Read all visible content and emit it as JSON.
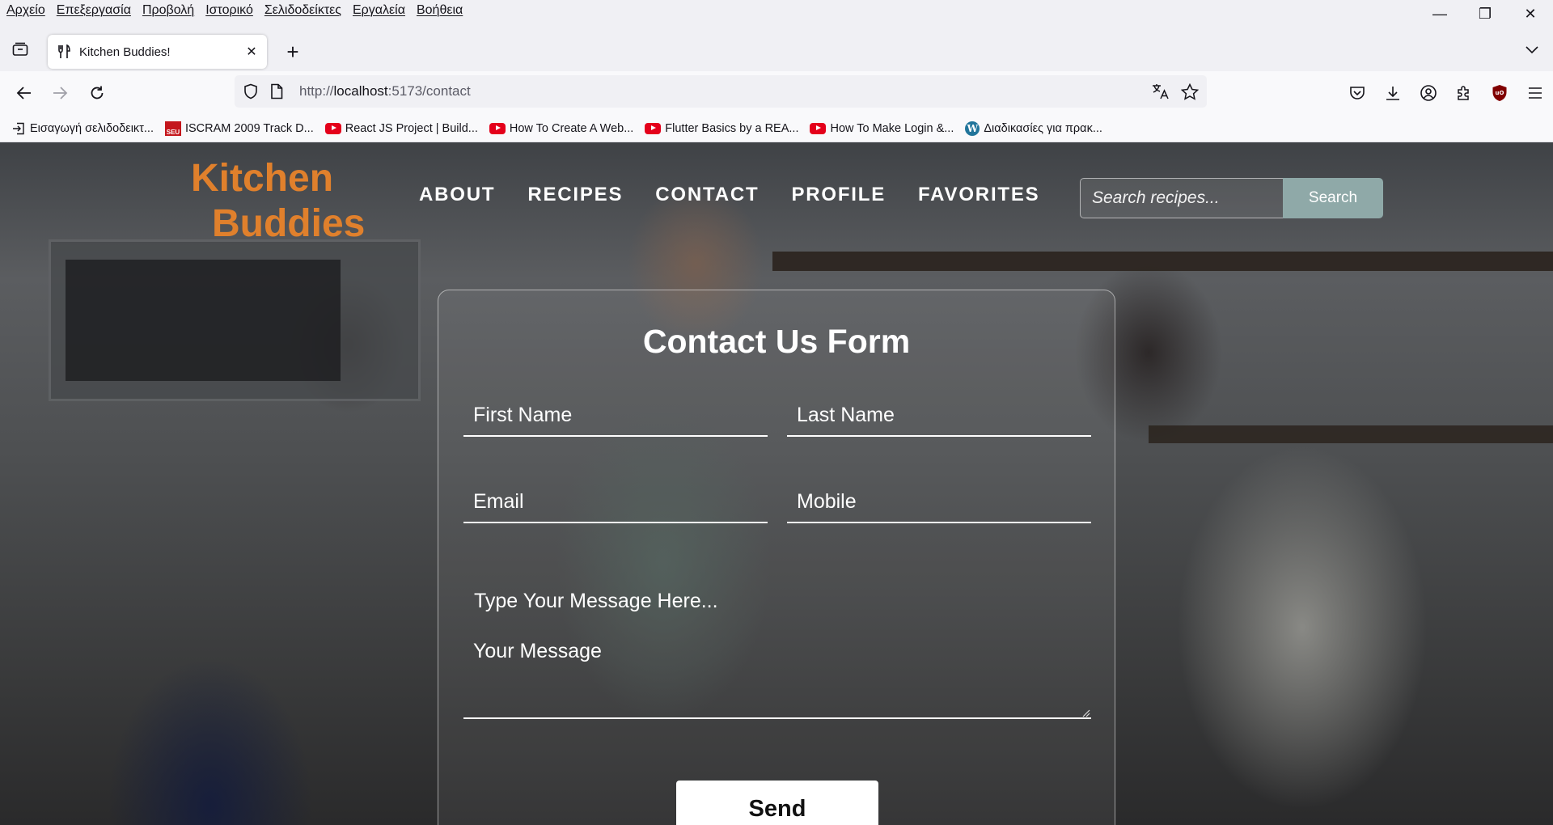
{
  "menubar": {
    "items": [
      "Αρχείο",
      "Επεξεργασία",
      "Προβολή",
      "Ιστορικό",
      "Σελιδοδείκτες",
      "Εργαλεία",
      "Βοήθεια"
    ]
  },
  "window_controls": {
    "minimize": "—",
    "restore": "❐",
    "close": "✕"
  },
  "tab": {
    "title": "Kitchen Buddies!",
    "close": "✕"
  },
  "new_tab": "+",
  "urlbar": {
    "prefix": "http://",
    "host": "localhost",
    "rest": ":5173/contact"
  },
  "bookmarks": [
    {
      "label": "Εισαγωγή σελιδοδεικτ...",
      "icon": "import-icon"
    },
    {
      "label": "ISCRAM 2009 Track D...",
      "icon": "seu-favicon",
      "badge": "SEU"
    },
    {
      "label": "React JS Project | Build...",
      "icon": "youtube-icon"
    },
    {
      "label": "How To Create A Web...",
      "icon": "youtube-icon"
    },
    {
      "label": "Flutter Basics by a REA...",
      "icon": "youtube-icon"
    },
    {
      "label": "How To Make Login &...",
      "icon": "youtube-icon"
    },
    {
      "label": "Διαδικασίες για πρακ...",
      "icon": "wordpress-icon",
      "badge": "W"
    }
  ],
  "site": {
    "logo": {
      "line1": "Kitchen",
      "line2": "Buddies"
    },
    "nav": [
      "ABOUT",
      "RECIPES",
      "CONTACT",
      "PROFILE",
      "FAVORITES"
    ],
    "search": {
      "placeholder": "Search recipes...",
      "button": "Search"
    }
  },
  "form": {
    "title": "Contact Us Form",
    "first_name_placeholder": "First Name",
    "last_name_placeholder": "Last Name",
    "email_placeholder": "Email",
    "mobile_placeholder": "Mobile",
    "message_hint": "Type Your Message Here...",
    "message_placeholder": "Your Message",
    "send": "Send"
  },
  "colors": {
    "logo": "#e0802c",
    "search_button": "#8fa9a8",
    "ublock": "#800000"
  }
}
